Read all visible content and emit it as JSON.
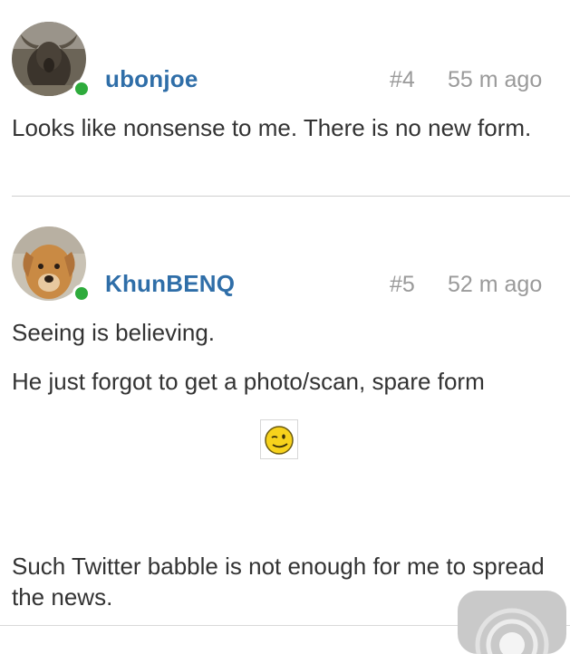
{
  "posts": [
    {
      "username": "ubonjoe",
      "post_number": "#4",
      "time_ago": "55 m ago",
      "avatar_icon": "water-buffalo-avatar",
      "paragraphs": [
        "Looks like nonsense to me. There is no new form."
      ]
    },
    {
      "username": "KhunBENQ",
      "post_number": "#5",
      "time_ago": "52 m ago",
      "avatar_icon": "dog-avatar",
      "paragraphs": [
        "Seeing is believing.",
        "He just forgot to get a photo/scan, spare form",
        "Such Twitter babble is not enough for me to spread the news."
      ],
      "emoji_icon": "wink-smiley-icon"
    }
  ],
  "colors": {
    "username": "#2f6ea8",
    "meta": "#9a9a9a",
    "online": "#2eab3c",
    "text": "#333333",
    "divider": "#cfcfcf"
  }
}
